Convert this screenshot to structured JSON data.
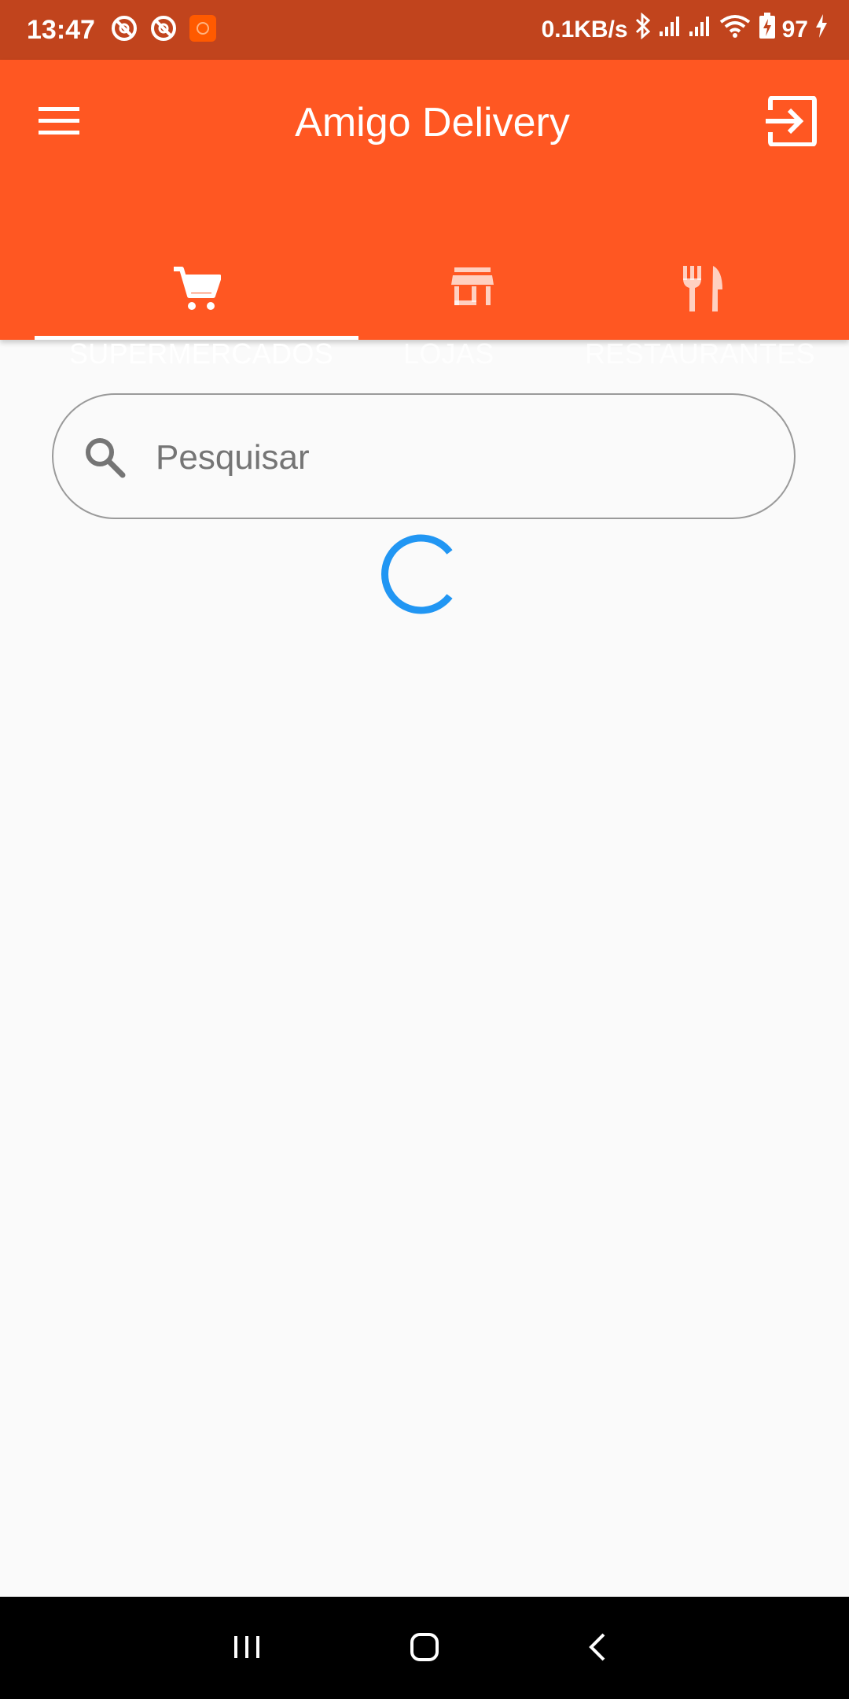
{
  "status_bar": {
    "time": "13:47",
    "net_speed": "0.1KB/s",
    "battery": "97",
    "icons": [
      "do-not-disturb-icon",
      "do-not-disturb-icon",
      "app-notification-icon",
      "bluetooth-icon",
      "signal-icon",
      "signal-icon",
      "wifi-icon",
      "battery-icon",
      "charging-icon"
    ]
  },
  "app_bar": {
    "title": "Amigo Delivery",
    "menu_icon": "menu-icon",
    "logout_icon": "logout-icon",
    "color": "#ff5722"
  },
  "tabs": [
    {
      "label": "SUPERMERCADOS",
      "icon": "cart-icon",
      "active": true
    },
    {
      "label": "LOJAS",
      "icon": "store-icon",
      "active": false
    },
    {
      "label": "RESTAURANTES",
      "icon": "restaurant-icon",
      "active": false
    }
  ],
  "search": {
    "placeholder": "Pesquisar",
    "value": "",
    "icon": "search-icon"
  },
  "loading": {
    "indicator": "progress-spinner",
    "color": "#2196f3"
  },
  "nav_bar": {
    "buttons": [
      "recents-icon",
      "home-icon",
      "back-icon"
    ]
  }
}
